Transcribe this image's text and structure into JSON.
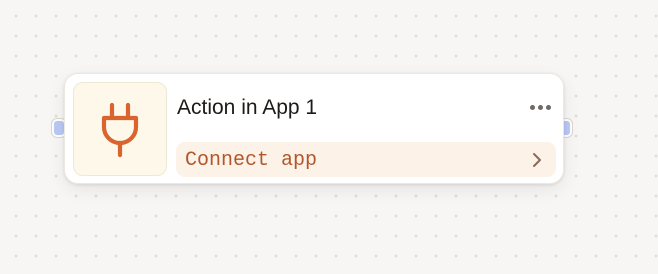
{
  "node": {
    "title": "Action in App 1",
    "app_icon": "plug-icon",
    "connect_label": "Connect app",
    "more_icon": "more-horizontal-icon",
    "chevron_icon": "chevron-right-icon"
  },
  "colors": {
    "canvas_background": "#f8f6f4",
    "card_background": "#ffffff",
    "icon_box_background": "#fdf8ea",
    "accent_orange": "#d9642e",
    "connect_background": "#fdf2e7",
    "connect_text": "#b0582c",
    "port_fill": "#b9c8f5"
  }
}
